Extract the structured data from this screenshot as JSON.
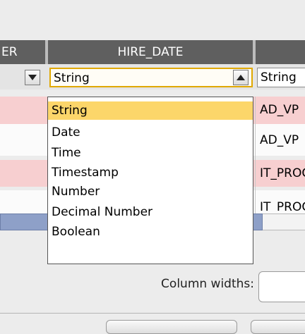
{
  "table": {
    "columns": [
      {
        "header": "ER"
      },
      {
        "header": "HIRE_DATE"
      },
      {
        "header": ""
      }
    ],
    "type_row": {
      "hire_date_type": "String",
      "next_type": "String"
    },
    "rows": [
      {
        "value": "AD_VP",
        "style": "pink"
      },
      {
        "value": "AD_VP",
        "style": "white"
      },
      {
        "value": "IT_PROG",
        "style": "pink"
      },
      {
        "value": "IT_PROG",
        "style": "white"
      }
    ]
  },
  "dropdown": {
    "selected": "String",
    "options": [
      "String",
      "Date",
      "Time",
      "Timestamp",
      "Number",
      "Decimal Number",
      "Boolean"
    ]
  },
  "settings": {
    "column_widths_label": "Column widths:"
  }
}
